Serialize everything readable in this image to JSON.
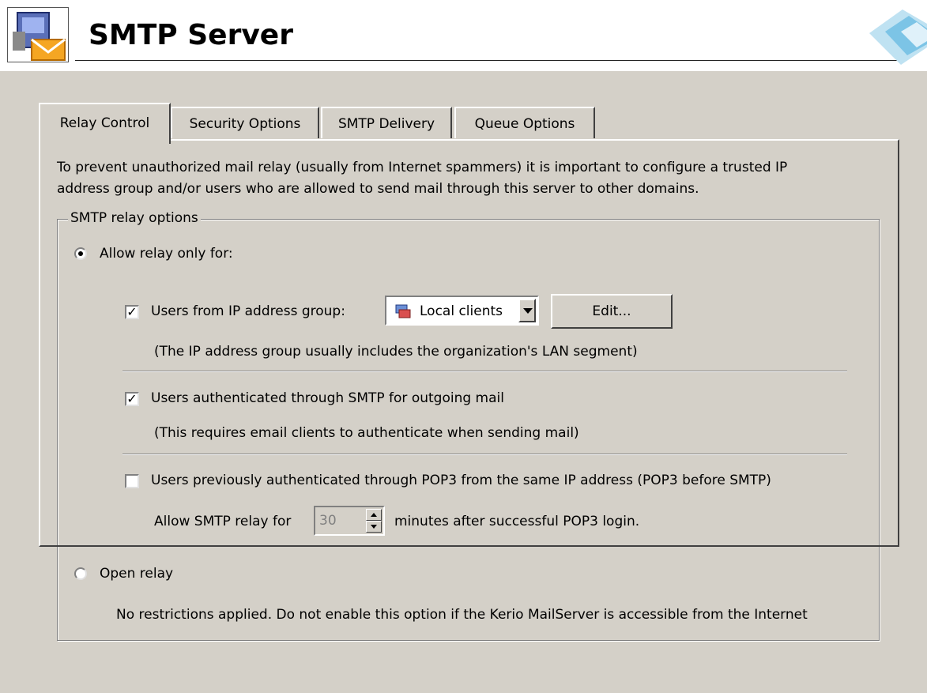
{
  "header": {
    "title": "SMTP Server",
    "app_icon": "mail-server-icon",
    "logo_icon": "kerio-logo-icon"
  },
  "tabs": [
    {
      "label": "Relay Control",
      "active": true
    },
    {
      "label": "Security Options",
      "active": false
    },
    {
      "label": "SMTP Delivery",
      "active": false
    },
    {
      "label": "Queue Options",
      "active": false
    }
  ],
  "relay": {
    "intro_line1": "To prevent unauthorized mail relay (usually from Internet spammers) it is important to configure a trusted IP",
    "intro_line2": "address group and/or users who are allowed to send mail through this server to other domains.",
    "group_label": "SMTP relay options",
    "allow_relay_label": "Allow relay only for:",
    "allow_relay_selected": true,
    "ip_group_label": "Users from IP address group:",
    "ip_group_checked": true,
    "ip_group_value": "Local clients",
    "edit_button": "Edit...",
    "ip_group_note": "(The IP address group usually includes the organization's LAN segment)",
    "smtp_auth_label": "Users authenticated through SMTP for outgoing mail",
    "smtp_auth_checked": true,
    "smtp_auth_note": "(This requires email clients to authenticate when sending mail)",
    "pop3_label": "Users previously authenticated through POP3 from the same IP address (POP3 before SMTP)",
    "pop3_checked": false,
    "allow_for_label": "Allow SMTP relay for",
    "minutes_value": "30",
    "minutes_after_label": "minutes after successful POP3 login.",
    "open_relay_label": "Open relay",
    "open_relay_selected": false,
    "open_relay_note": "No restrictions applied. Do not enable this option if the Kerio MailServer is accessible from the Internet"
  }
}
